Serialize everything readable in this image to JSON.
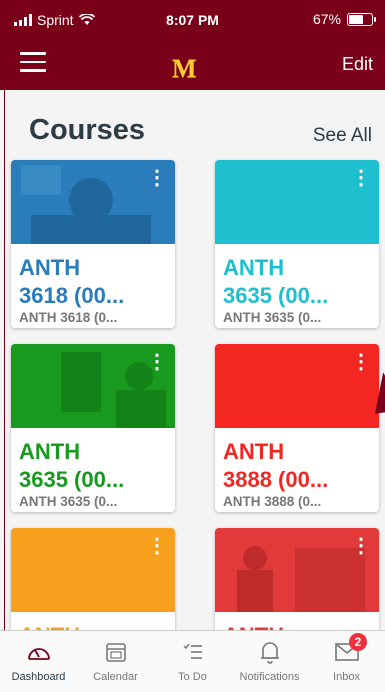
{
  "status": {
    "carrier": "Sprint",
    "time": "8:07 PM",
    "battery": "67%"
  },
  "header": {
    "logo": "M",
    "edit_label": "Edit"
  },
  "section": {
    "title": "Courses",
    "see_all": "See All"
  },
  "courses": [
    {
      "code": "ANTH 3618 (00...",
      "code_line1": "ANTH",
      "code_line2": "3618 (00...",
      "term": "ANTH 3618 (0...",
      "color": "#2a7dba"
    },
    {
      "code": "ANTH 3635 (00...",
      "code_line1": "ANTH",
      "code_line2": "3635 (00...",
      "term": "ANTH 3635 (0...",
      "color": "#1ec0d0"
    },
    {
      "code": "ANTH 3635 (00...",
      "code_line1": "ANTH",
      "code_line2": "3635 (00...",
      "term": "ANTH 3635 (0...",
      "color": "#189a1e"
    },
    {
      "code": "ANTH 3888 (00...",
      "code_line1": "ANTH",
      "code_line2": "3888 (00...",
      "term": "ANTH 3888 (0...",
      "color": "#f42622"
    },
    {
      "code": "ANTH",
      "code_line1": "ANTH",
      "code_line2": "",
      "term": "",
      "color": "#f6a01d"
    },
    {
      "code": "ANTH",
      "code_line1": "ANTH",
      "code_line2": "",
      "term": "",
      "color": "#e23a3a"
    }
  ],
  "tabs": [
    {
      "label": "Dashboard",
      "icon": "dashboard-icon",
      "active": true
    },
    {
      "label": "Calendar",
      "icon": "calendar-icon"
    },
    {
      "label": "To Do",
      "icon": "todo-icon"
    },
    {
      "label": "Notifications",
      "icon": "bell-icon"
    },
    {
      "label": "Inbox",
      "icon": "envelope-icon",
      "badge": "2"
    }
  ],
  "colors": {
    "brand_maroon": "#7a0019",
    "brand_gold": "#ffcc33",
    "text_dark": "#2d3b45"
  }
}
